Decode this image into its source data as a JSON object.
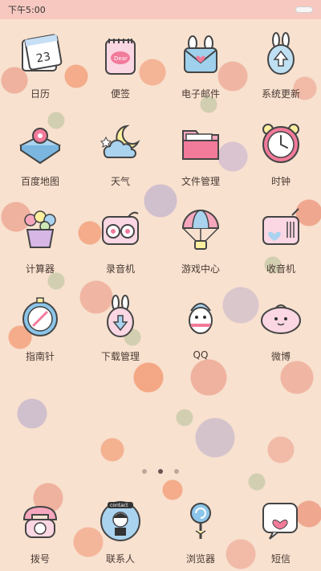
{
  "status_bar": {
    "time": "下午5:00"
  },
  "apps": [
    {
      "label": "日历",
      "icon": "calendar-icon",
      "text": "23"
    },
    {
      "label": "便签",
      "icon": "notes-icon",
      "text": "Dear"
    },
    {
      "label": "电子邮件",
      "icon": "email-icon"
    },
    {
      "label": "系统更新",
      "icon": "update-icon"
    },
    {
      "label": "百度地图",
      "icon": "map-icon"
    },
    {
      "label": "天气",
      "icon": "weather-icon"
    },
    {
      "label": "文件管理",
      "icon": "folder-icon"
    },
    {
      "label": "时钟",
      "icon": "clock-icon"
    },
    {
      "label": "计算器",
      "icon": "calculator-icon"
    },
    {
      "label": "录音机",
      "icon": "recorder-icon"
    },
    {
      "label": "游戏中心",
      "icon": "game-center-icon"
    },
    {
      "label": "收音机",
      "icon": "radio-icon"
    },
    {
      "label": "指南针",
      "icon": "compass-icon"
    },
    {
      "label": "下载管理",
      "icon": "download-icon"
    },
    {
      "label": "QQ",
      "icon": "qq-icon"
    },
    {
      "label": "微博",
      "icon": "weibo-icon"
    }
  ],
  "pager": {
    "pages": 3,
    "active": 2
  },
  "dock": [
    {
      "label": "拨号",
      "icon": "phone-icon"
    },
    {
      "label": "联系人",
      "icon": "contacts-icon",
      "text": "contact"
    },
    {
      "label": "浏览器",
      "icon": "browser-icon"
    },
    {
      "label": "短信",
      "icon": "sms-icon"
    }
  ],
  "colors": {
    "status_bar": "#f5b4b4",
    "label_text": "#4a3a34",
    "wallpaper": "#f8e1cf"
  }
}
